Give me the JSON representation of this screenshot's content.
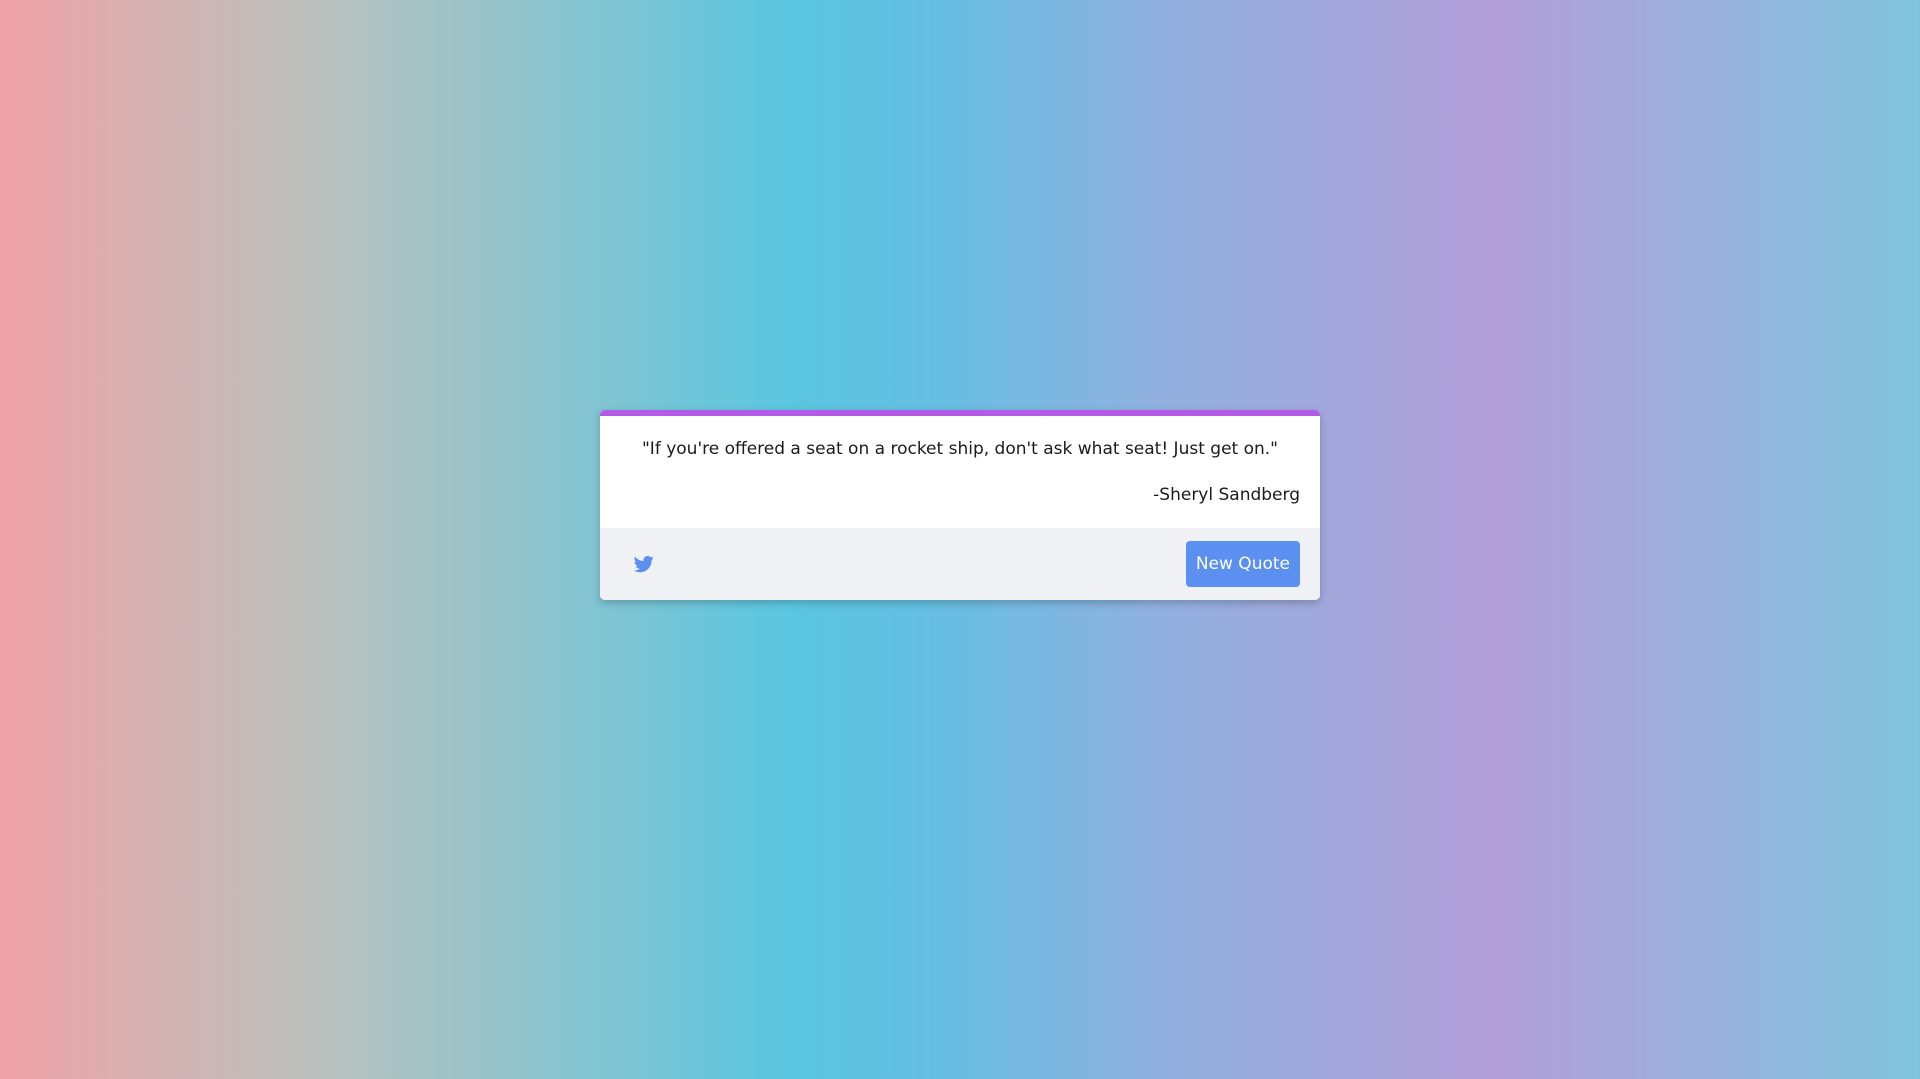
{
  "colors": {
    "accent_bar": "#b35ae6",
    "button_bg": "#5b8ff0",
    "twitter_icon": "#5b8ff0",
    "footer_bg": "#f0f1f4"
  },
  "quote": {
    "text": "\"If you're offered a seat on a rocket ship, don't ask what seat! Just get on.\"",
    "author": "-Sheryl Sandberg"
  },
  "footer": {
    "tweet_icon": "twitter-icon",
    "new_quote_label": "New Quote"
  }
}
